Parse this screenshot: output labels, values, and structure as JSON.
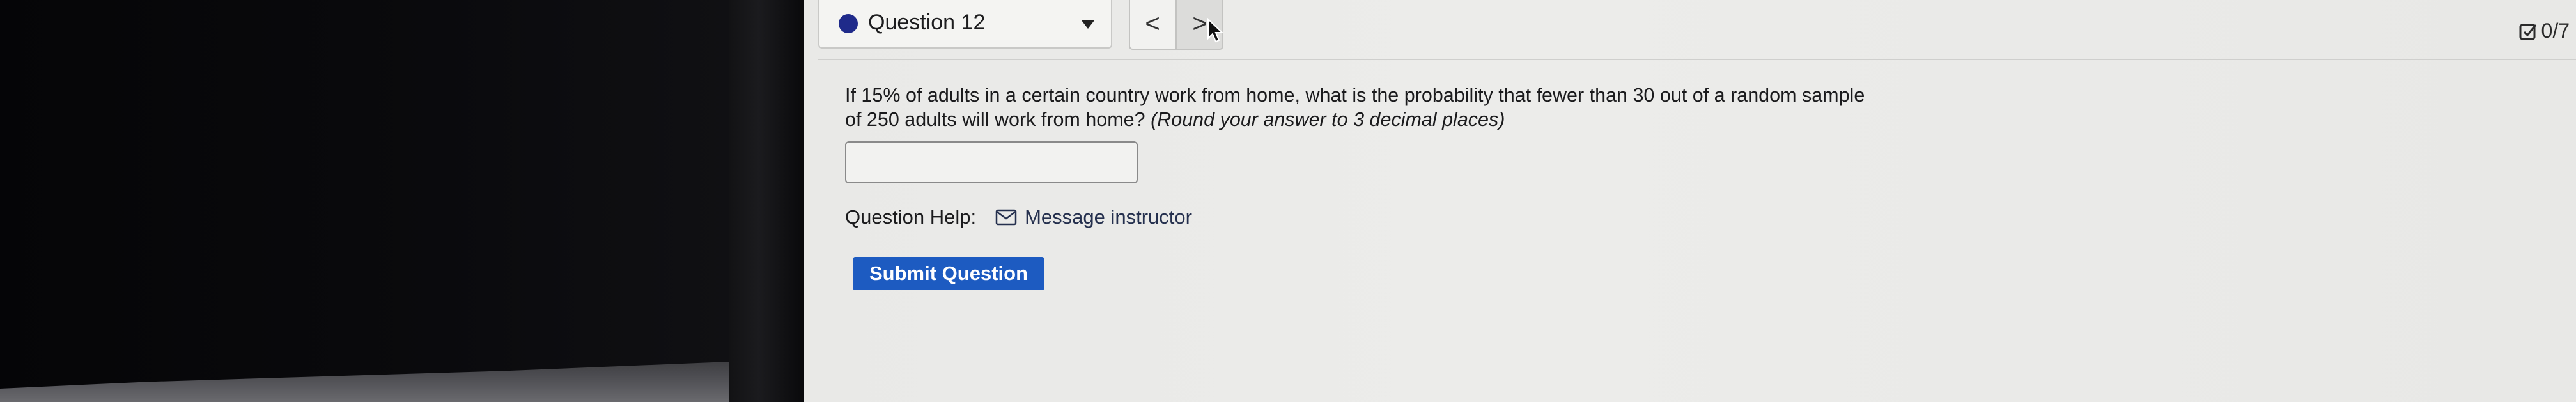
{
  "nav": {
    "question_label": "Question 12",
    "prev_label": "<",
    "next_label": ">",
    "progress": "0/7"
  },
  "question": {
    "text": "If 15% of adults in a certain country work from home, what is the probability that fewer than 30 out of a random sample of 250 adults will work from home?",
    "hint": "(Round your answer to 3 decimal places)",
    "answer_value": "",
    "answer_placeholder": ""
  },
  "help": {
    "label": "Question Help:",
    "message_link": "Message instructor"
  },
  "submit": {
    "label": "Submit Question"
  },
  "colors": {
    "status_dot": "#1f2a8a",
    "submit_bg": "#1d5bc1"
  },
  "icons": [
    "status-dot-icon",
    "chevron-down-icon",
    "chevron-left-icon",
    "chevron-right-icon",
    "mouse-cursor-icon",
    "checkbox-icon",
    "mail-icon"
  ]
}
